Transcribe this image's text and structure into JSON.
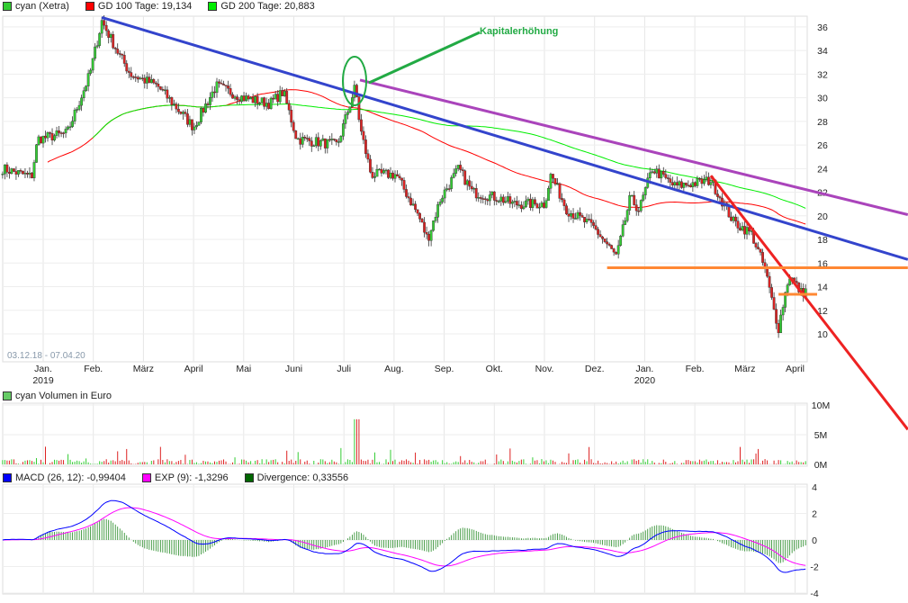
{
  "legend": {
    "main": [
      {
        "label": "cyan (Xetra)",
        "color": "#33cc33"
      },
      {
        "label": "GD 100 Tage: 19,134",
        "color": "#ff0000"
      },
      {
        "label": "GD 200 Tage: 20,883",
        "color": "#00ee00"
      }
    ],
    "volume": {
      "label": "cyan Volumen in Euro",
      "color": "#66cc66"
    },
    "macd": [
      {
        "label": "MACD (26, 12): -0,99404",
        "color": "#0000ff"
      },
      {
        "label": "EXP (9): -1,3296",
        "color": "#ff00ff"
      },
      {
        "label": "Divergence: 0,33556",
        "color": "#006600"
      }
    ]
  },
  "chart_data": {
    "type": "line",
    "date_range": "03.12.18 - 07.04.20",
    "x_ticks": [
      {
        "t": 0,
        "label": "Jan.",
        "sub": "2019"
      },
      {
        "t": 1,
        "label": "Feb."
      },
      {
        "t": 2,
        "label": "März"
      },
      {
        "t": 3,
        "label": "April"
      },
      {
        "t": 4,
        "label": "Mai"
      },
      {
        "t": 5,
        "label": "Juni"
      },
      {
        "t": 6,
        "label": "Juli"
      },
      {
        "t": 7,
        "label": "Aug."
      },
      {
        "t": 8,
        "label": "Sep."
      },
      {
        "t": 9,
        "label": "Okt."
      },
      {
        "t": 10,
        "label": "Nov."
      },
      {
        "t": 11,
        "label": "Dez."
      },
      {
        "t": 12,
        "label": "Jan.",
        "sub": "2020"
      },
      {
        "t": 13,
        "label": "Feb."
      },
      {
        "t": 14,
        "label": "März"
      },
      {
        "t": 15,
        "label": "April"
      }
    ],
    "price_ticks": [
      "10",
      "12",
      "14",
      "16",
      "18",
      "20",
      "22",
      "24",
      "26",
      "28",
      "30",
      "32",
      "34",
      "36"
    ],
    "price_ylim": [
      10,
      36
    ],
    "price_keypoints": [
      [
        -0.81,
        24
      ],
      [
        -0.23,
        23.3
      ],
      [
        -0.11,
        26.5
      ],
      [
        0.48,
        27
      ],
      [
        0.93,
        32
      ],
      [
        1.17,
        36.5
      ],
      [
        1.47,
        34
      ],
      [
        1.74,
        32
      ],
      [
        2.28,
        31
      ],
      [
        3.0,
        27.5
      ],
      [
        3.45,
        31
      ],
      [
        3.99,
        30
      ],
      [
        4.52,
        29.5
      ],
      [
        4.79,
        30.5
      ],
      [
        5.06,
        26.5
      ],
      [
        5.87,
        26
      ],
      [
        6.23,
        31
      ],
      [
        6.32,
        27.5
      ],
      [
        6.54,
        23.5
      ],
      [
        7.04,
        23.5
      ],
      [
        7.49,
        20
      ],
      [
        7.67,
        18
      ],
      [
        7.93,
        21.5
      ],
      [
        8.29,
        24
      ],
      [
        8.56,
        22
      ],
      [
        9.1,
        21.5
      ],
      [
        9.37,
        21
      ],
      [
        10.0,
        21
      ],
      [
        10.13,
        23.5
      ],
      [
        10.45,
        20.5
      ],
      [
        10.99,
        19
      ],
      [
        11.44,
        16.5
      ],
      [
        11.71,
        21.5
      ],
      [
        11.89,
        20.5
      ],
      [
        12.15,
        24
      ],
      [
        12.6,
        22.5
      ],
      [
        13.32,
        23
      ],
      [
        13.77,
        19.5
      ],
      [
        14.13,
        18.5
      ],
      [
        14.31,
        16.5
      ],
      [
        14.4,
        15.5
      ],
      [
        14.58,
        12
      ],
      [
        14.67,
        10.5
      ],
      [
        14.76,
        12.5
      ],
      [
        14.88,
        15
      ],
      [
        15.12,
        13.5
      ],
      [
        15.24,
        13.7
      ]
    ],
    "volume_ticks": [
      "0M",
      "5M",
      "10M"
    ],
    "volume_ylim": [
      0,
      10
    ],
    "macd_ticks": [
      "-4",
      "-2",
      "0",
      "2",
      "4"
    ],
    "macd_ylim": [
      -4,
      4
    ],
    "annotation": "Kapitalerhöhung",
    "trendlines": [
      {
        "name": "blue-trendline",
        "color": "#3344cc",
        "from": [
          1.17,
          36.8
        ],
        "to": [
          17.25,
          16.3
        ]
      },
      {
        "name": "purple-trendline",
        "color": "#aa44bb",
        "from": [
          6.32,
          31.5
        ],
        "to": [
          17.25,
          20.1
        ]
      },
      {
        "name": "red-trendline",
        "color": "#ee2222",
        "from": [
          13.32,
          23.4
        ],
        "to": [
          17.25,
          1.9
        ]
      },
      {
        "name": "orange-support",
        "color": "#ff8833",
        "from": [
          11.25,
          15.6
        ],
        "to": [
          17.25,
          15.6
        ]
      },
      {
        "name": "orange-support-short",
        "color": "#ff8833",
        "from": [
          14.67,
          13.35
        ],
        "to": [
          15.44,
          13.35
        ]
      }
    ]
  }
}
